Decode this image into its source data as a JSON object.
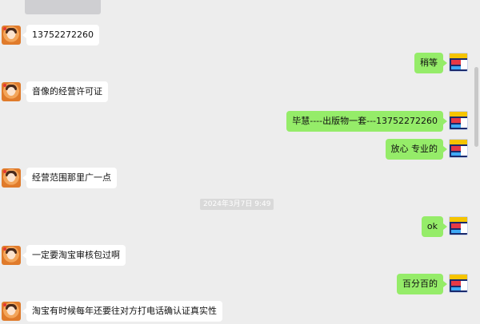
{
  "messages": [
    {
      "side": "in",
      "text": "13752272260"
    },
    {
      "side": "out",
      "text": "稍等"
    },
    {
      "side": "in",
      "text": "音像的经营许可证"
    },
    {
      "side": "out",
      "text": "毕慧----出版物一套---13752272260"
    },
    {
      "side": "out",
      "text": "放心 专业的"
    },
    {
      "side": "in",
      "text": "经营范围那里广一点"
    },
    {
      "side": "out",
      "text": "ok"
    },
    {
      "side": "in",
      "text": "一定要淘宝审核包过啊"
    },
    {
      "side": "out",
      "text": "百分百的"
    },
    {
      "side": "in",
      "text": "淘宝有时候每年还要往对方打电话确认证真实性"
    }
  ],
  "timestamp": "2024年3月7日 9:49",
  "colors": {
    "background": "#ededed",
    "incoming_bubble": "#ffffff",
    "outgoing_bubble": "#95ec69",
    "timestamp_bg": "#d9d9d9"
  }
}
